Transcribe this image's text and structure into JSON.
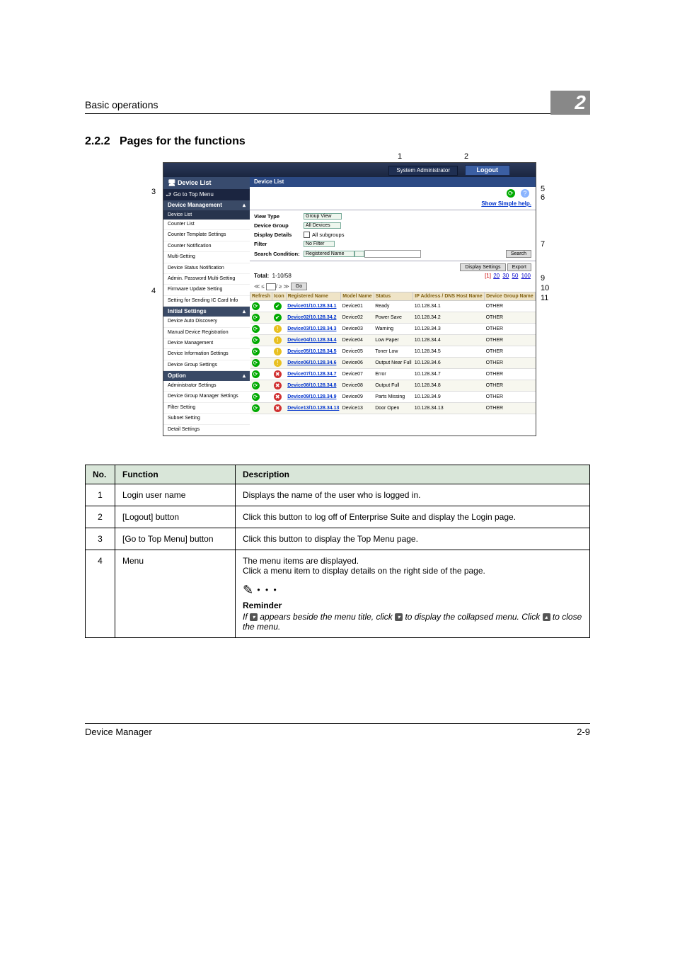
{
  "page_header": "Basic operations",
  "chapter_badge": "2",
  "section_number": "2.2.2",
  "section_title": "Pages for the functions",
  "callouts": {
    "c1": "1",
    "c2": "2",
    "c3": "3",
    "c4": "4",
    "c5": "5",
    "c6": "6",
    "c7": "7",
    "c9": "9",
    "c10": "10",
    "c11": "11"
  },
  "ss": {
    "sysadmin": "System Administrator",
    "logout": "Logout",
    "side_title": "Device List",
    "go_top": "Go to Top Menu",
    "grp_devmgmt": "Device Management",
    "grp_init": "Initial Settings",
    "grp_option": "Option",
    "side": {
      "device_list": "Device List",
      "counter_list": "Counter List",
      "counter_tpl": "Counter Template Settings",
      "counter_notif": "Counter Notification",
      "multi_setting": "Multi-Setting",
      "dev_status_notif": "Device Status Notification",
      "admin_pw_multi": "Admin. Password Multi-Setting",
      "fw_update": "Firmware Update Setting",
      "ic_card": "Setting for Sending IC Card Info",
      "auto_disc": "Device Auto Discovery",
      "manual_reg": "Manual Device Registration",
      "dev_mgmt": "Device Management",
      "dev_info": "Device Information Settings",
      "dev_group": "Device Group Settings",
      "admin_settings": "Administrator Settings",
      "dgm_settings": "Device Group Manager Settings",
      "filter_setting": "Filter Setting",
      "subnet_setting": "Subnet Setting",
      "detail_setting": "Detail Settings"
    },
    "main_title": "Device List",
    "simple": "Show Simple help.",
    "row_view_type": "View Type",
    "row_view_type_val": "Group View",
    "row_dev_group": "Device Group",
    "row_dev_group_val": "All Devices",
    "row_disp_det": "Display Details",
    "row_disp_det_val": "All subgroups",
    "row_filter": "Filter",
    "row_filter_val": "No Filter",
    "row_search": "Search Condition:",
    "row_search_opt": "Registered Name",
    "btn_search": "Search",
    "btn_disp": "Display Settings",
    "btn_export": "Export",
    "total_label": "Total:",
    "total_val": "1-10/58",
    "pager": [
      "[1]",
      "20",
      "30",
      "50",
      "100"
    ],
    "pager_go": "Go",
    "th": {
      "refresh": "Refresh",
      "icon": "Icon",
      "regname": "Registered Name",
      "model": "Model Name",
      "status": "Status",
      "ip": "IP Address / DNS Host Name",
      "grp": "Device Group Name"
    },
    "rows": [
      {
        "name": "Device01/10.128.34.1",
        "model": "Device01",
        "status": "Ready",
        "ip": "10.128.34.1",
        "grp": "OTHER",
        "ic": "ok"
      },
      {
        "name": "Device02/10.128.34.2",
        "model": "Device02",
        "status": "Power Save",
        "ip": "10.128.34.2",
        "grp": "OTHER",
        "ic": "ok"
      },
      {
        "name": "Device03/10.128.34.3",
        "model": "Device03",
        "status": "Warning",
        "ip": "10.128.34.3",
        "grp": "OTHER",
        "ic": "warn"
      },
      {
        "name": "Device04/10.128.34.4",
        "model": "Device04",
        "status": "Low Paper",
        "ip": "10.128.34.4",
        "grp": "OTHER",
        "ic": "warn"
      },
      {
        "name": "Device05/10.128.34.5",
        "model": "Device05",
        "status": "Toner Low",
        "ip": "10.128.34.5",
        "grp": "OTHER",
        "ic": "warn"
      },
      {
        "name": "Device06/10.128.34.6",
        "model": "Device06",
        "status": "Output Near Full",
        "ip": "10.128.34.6",
        "grp": "OTHER",
        "ic": "warn"
      },
      {
        "name": "Device07/10.128.34.7",
        "model": "Device07",
        "status": "Error",
        "ip": "10.128.34.7",
        "grp": "OTHER",
        "ic": "err"
      },
      {
        "name": "Device08/10.128.34.8",
        "model": "Device08",
        "status": "Output Full",
        "ip": "10.128.34.8",
        "grp": "OTHER",
        "ic": "err"
      },
      {
        "name": "Device09/10.128.34.9",
        "model": "Device09",
        "status": "Parts Missing",
        "ip": "10.128.34.9",
        "grp": "OTHER",
        "ic": "err"
      },
      {
        "name": "Device13/10.128.34.13",
        "model": "Device13",
        "status": "Door Open",
        "ip": "10.128.34.13",
        "grp": "OTHER",
        "ic": "err"
      }
    ]
  },
  "table": {
    "h_no": "No.",
    "h_fn": "Function",
    "h_desc": "Description",
    "r1n": "1",
    "r1f": "Login user name",
    "r1d": "Displays the name of the user who is logged in.",
    "r2n": "2",
    "r2f": "[Logout] button",
    "r2d": "Click this button to log off of Enterprise Suite and display the Login page.",
    "r3n": "3",
    "r3f": "[Go to Top Menu] button",
    "r3d": "Click this button to display the Top Menu page.",
    "r4n": "4",
    "r4f": "Menu",
    "r4d1": "The menu items are displayed.",
    "r4d2": "Click a menu item to display details on the right side of the page.",
    "r4_rem_h": "Reminder",
    "r4_rem_a": "If ",
    "r4_rem_b": " appears beside the menu title, click ",
    "r4_rem_c": " to display the collapsed menu. Click ",
    "r4_rem_d": " to close the menu."
  },
  "footer_left": "Device Manager",
  "footer_right": "2-9"
}
